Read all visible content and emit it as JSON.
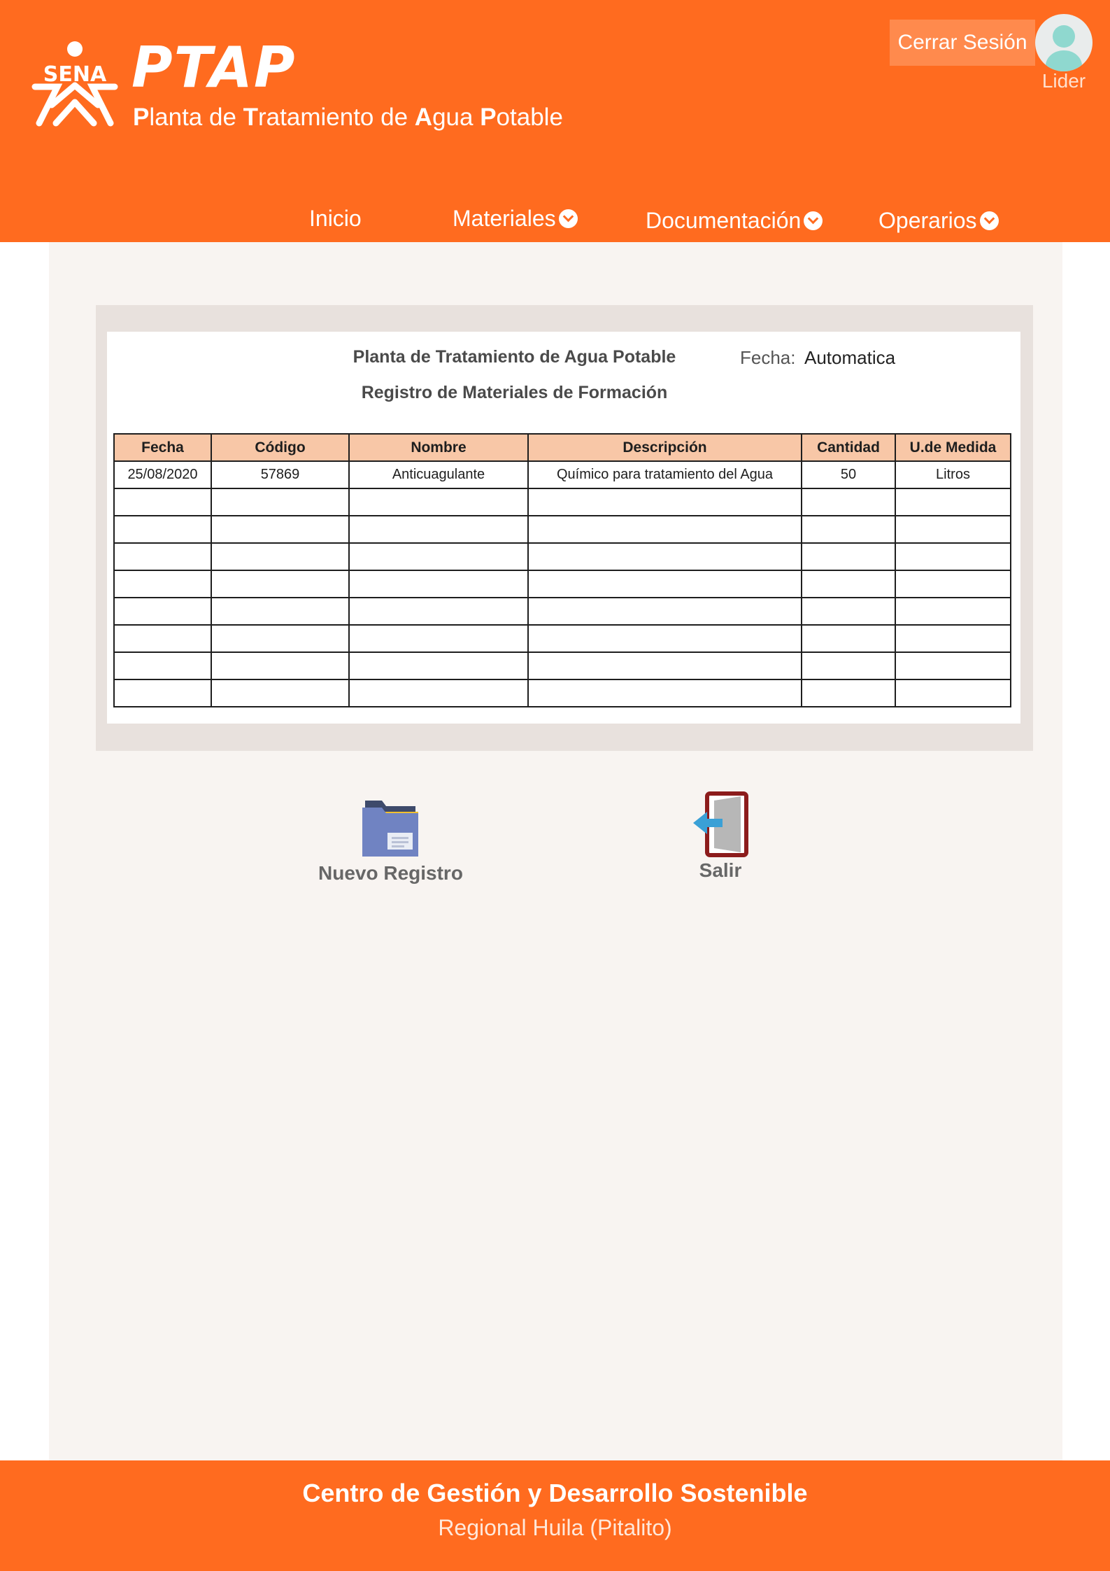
{
  "header": {
    "logo_text": "SENA",
    "title": "PTAP",
    "subtitle": {
      "w1_initial": "P",
      "w1_rest": "lanta de ",
      "w2_initial": "T",
      "w2_rest": "ratamiento de ",
      "w3_initial": "A",
      "w3_rest": "gua ",
      "w4_initial": "P",
      "w4_rest": "otable"
    },
    "logout_label": "Cerrar Sesión",
    "user_role": "Lider"
  },
  "nav": {
    "items": [
      {
        "label": "Inicio"
      },
      {
        "label": "Materiales"
      },
      {
        "label": "Documentación"
      },
      {
        "label": "Operarios"
      }
    ]
  },
  "form": {
    "title": "Planta de Tratamiento de Agua Potable",
    "subtitle": "Registro de Materiales de Formación",
    "fecha_label": "Fecha:",
    "fecha_value": "Automatica",
    "columns": [
      "Fecha",
      "Código",
      "Nombre",
      "Descripción",
      "Cantidad",
      "U.de Medida"
    ],
    "rows": [
      [
        "25/08/2020",
        "57869",
        "Anticuagulante",
        "Químico para tratamiento del Agua",
        "50",
        "Litros"
      ],
      [
        "",
        "",
        "",
        "",
        "",
        ""
      ],
      [
        "",
        "",
        "",
        "",
        "",
        ""
      ],
      [
        "",
        "",
        "",
        "",
        "",
        ""
      ],
      [
        "",
        "",
        "",
        "",
        "",
        ""
      ],
      [
        "",
        "",
        "",
        "",
        "",
        ""
      ],
      [
        "",
        "",
        "",
        "",
        "",
        ""
      ],
      [
        "",
        "",
        "",
        "",
        "",
        ""
      ],
      [
        "",
        "",
        "",
        "",
        "",
        ""
      ]
    ]
  },
  "actions": {
    "new_record": {
      "label": "Nuevo Registro",
      "icon": "folder-icon"
    },
    "exit": {
      "label": "Salir",
      "icon": "exit-door-icon"
    }
  },
  "footer": {
    "title": "Centro de Gestión y Desarrollo Sostenible",
    "subtitle": "Regional Huila (Pitalito)"
  },
  "colors": {
    "brand_orange": "#ff6b1f",
    "table_header": "#f8c7a7",
    "panel_bg": "#f8f4f1"
  }
}
